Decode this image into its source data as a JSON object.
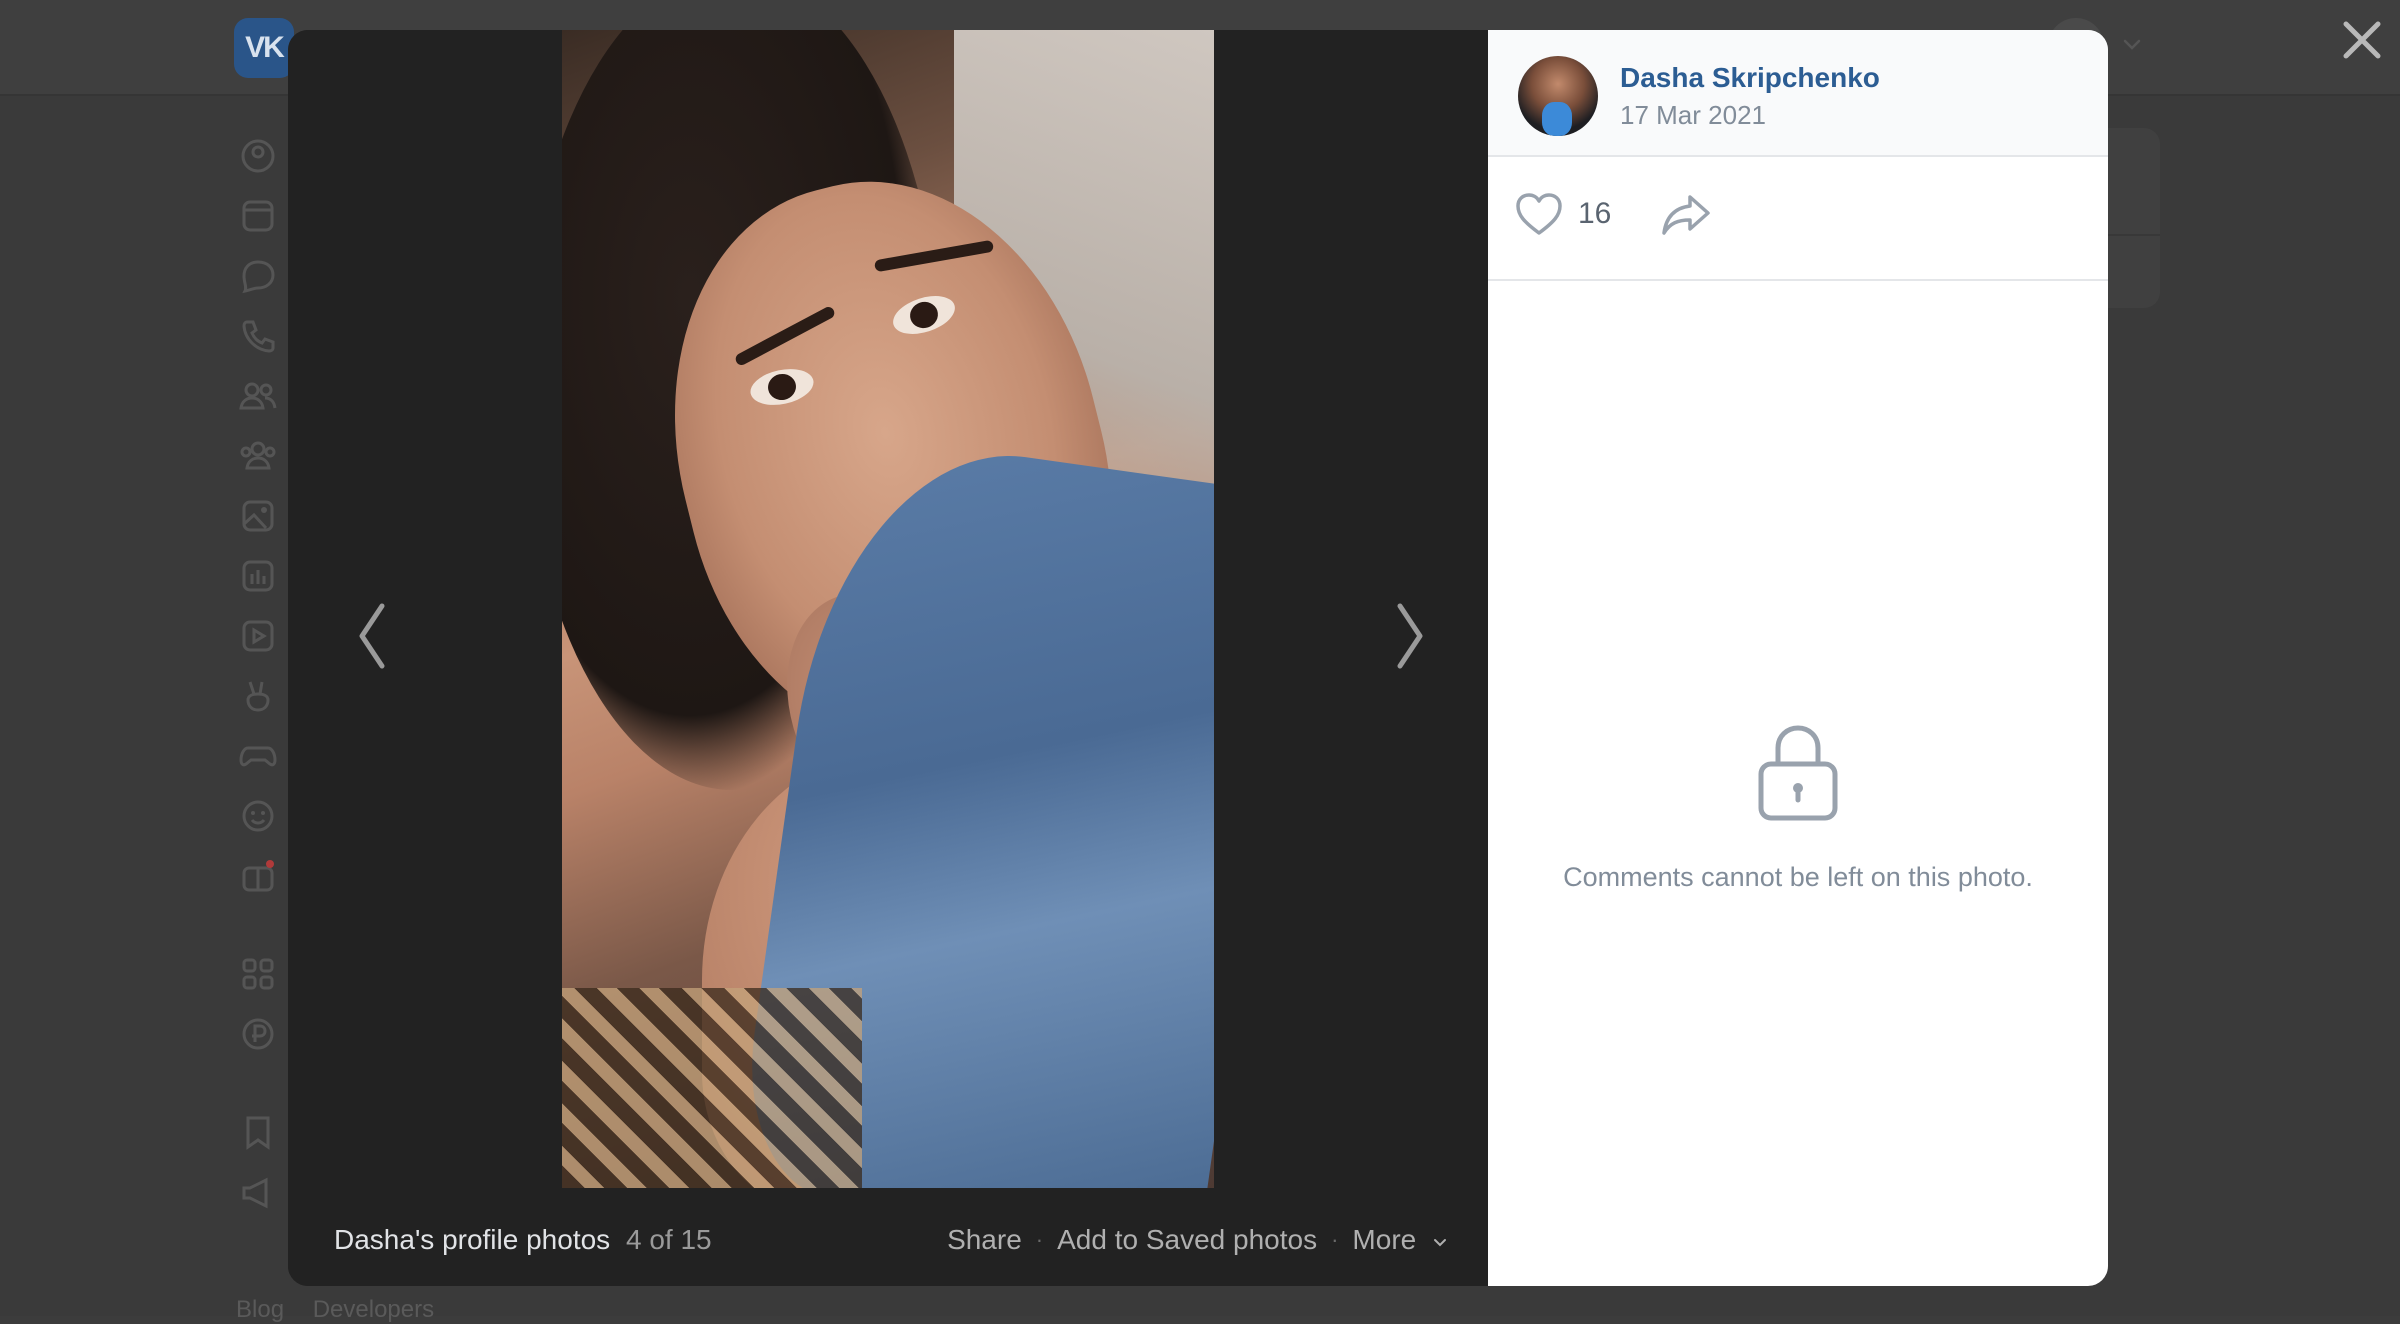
{
  "background": {
    "logo_text": "VK",
    "sidebar_icons": [
      "profile-icon",
      "news-icon",
      "messenger-icon",
      "calls-icon",
      "friends-icon",
      "communities-icon",
      "photos-icon",
      "music-icon",
      "video-icon",
      "clips-icon",
      "games-icon",
      "stickers-icon",
      "gifts-icon",
      "services-icon",
      "payments-icon",
      "bookmarks-icon",
      "ads-icon"
    ],
    "footer_links": [
      "Blog",
      "Developers"
    ]
  },
  "viewer": {
    "album_title": "Dasha's profile photos",
    "position": "4 of 15",
    "actions": {
      "share": "Share",
      "save": "Add to Saved photos",
      "more": "More"
    }
  },
  "panel": {
    "author_name": "Dasha Skripchenko",
    "date": "17 Mar 2021",
    "likes": "16",
    "comments_disabled_message": "Comments cannot be left on this photo."
  },
  "colors": {
    "link": "#2c5d93",
    "muted": "#818c99",
    "overlay": "#222222"
  }
}
